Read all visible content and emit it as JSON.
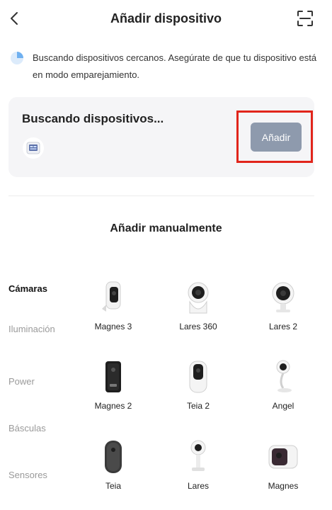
{
  "header": {
    "title": "Añadir dispositivo",
    "back_icon": "chevron-left-icon",
    "scan_icon": "scan-frame-icon"
  },
  "searching": {
    "hint": "Buscando dispositivos cercanos. Asegúrate de que tu dispositivo está en modo emparejamiento.",
    "icon": "searching-pulse-icon"
  },
  "found_card": {
    "title": "Buscando dispositivos...",
    "device_icon": "display-device-icon",
    "add_label": "Añadir",
    "add_button_color": "#8e9aad",
    "highlight_color": "#e1251b"
  },
  "manual": {
    "title": "Añadir manualmente",
    "categories": [
      {
        "label": "Cámaras",
        "active": true
      },
      {
        "label": "Iluminación",
        "active": false
      },
      {
        "label": "Power",
        "active": false
      },
      {
        "label": "Básculas",
        "active": false
      },
      {
        "label": "Sensores",
        "active": false
      }
    ],
    "devices": [
      {
        "label": "Magnes 3",
        "icon": "battery-camera-icon"
      },
      {
        "label": "Lares 360",
        "icon": "dome-camera-icon"
      },
      {
        "label": "Lares 2",
        "icon": "round-camera-icon"
      },
      {
        "label": "Magnes 2",
        "icon": "doorbell-camera-icon"
      },
      {
        "label": "Teia 2",
        "icon": "cylinder-camera-icon"
      },
      {
        "label": "Angel",
        "icon": "baby-camera-icon"
      },
      {
        "label": "Teia",
        "icon": "capsule-camera-icon"
      },
      {
        "label": "Lares",
        "icon": "mini-camera-icon"
      },
      {
        "label": "Magnes",
        "icon": "box-camera-icon"
      }
    ]
  }
}
